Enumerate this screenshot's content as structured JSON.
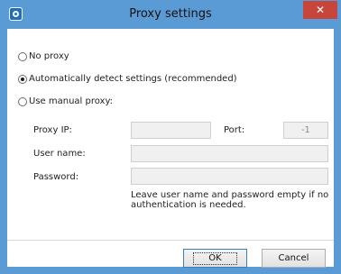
{
  "window": {
    "title": "Proxy settings",
    "close_glyph": "✕"
  },
  "options": {
    "no_proxy": "No proxy",
    "auto_detect": "Automatically detect settings (recommended)",
    "manual": "Use manual proxy:",
    "selected": "auto_detect"
  },
  "fields": {
    "proxy_ip_label": "Proxy IP:",
    "proxy_ip_value": "",
    "port_label": "Port:",
    "port_value": "-1",
    "username_label": "User name:",
    "username_value": "",
    "password_label": "Password:",
    "password_value": ""
  },
  "note": "Leave user name and password empty if no authentication is needed.",
  "buttons": {
    "ok": "OK",
    "cancel": "Cancel"
  }
}
